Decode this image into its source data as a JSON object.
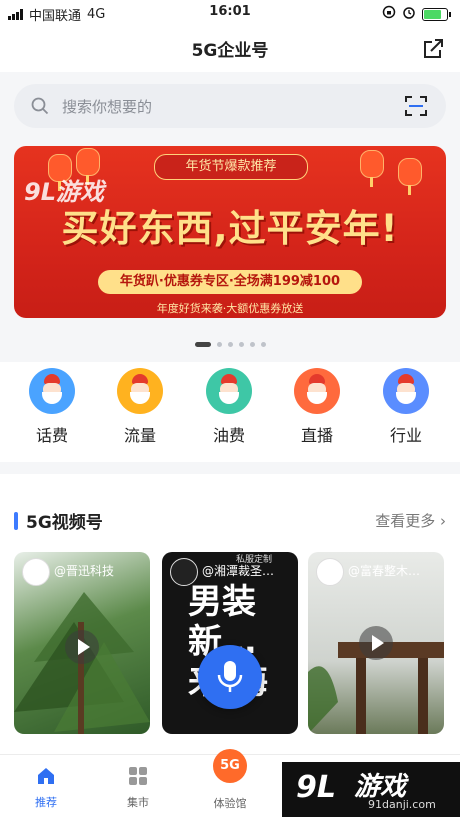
{
  "status_bar": {
    "carrier": "中国联通",
    "network": "4G",
    "time": "16:01"
  },
  "header": {
    "title": "5G企业号"
  },
  "search": {
    "placeholder": "搜索你想要的"
  },
  "banner": {
    "tag": "年货节爆款推荐",
    "headline": "买好东西,过平安年!",
    "promo": "年货趴·优惠券专区·全场满199减100",
    "footnote": "年度好货来袭·大额优惠券放送",
    "watermark": "9L游戏"
  },
  "carousel": {
    "count": 6,
    "active": 0
  },
  "quick_menu": [
    {
      "label": "话费",
      "color": "#4aa3ff"
    },
    {
      "label": "流量",
      "color": "#ffb21f"
    },
    {
      "label": "油费",
      "color": "#3ec7a6"
    },
    {
      "label": "直播",
      "color": "#ff6a3d"
    },
    {
      "label": "行业",
      "color": "#5a8dff"
    }
  ],
  "video_section": {
    "title": "5G视频号",
    "more": "查看更多",
    "cards": [
      {
        "name": "@晋迅科技"
      },
      {
        "name": "@湘潭裁圣…",
        "tag": "私服定制",
        "overlay": "男装 新…来 海"
      },
      {
        "name": "@富春整木…"
      }
    ]
  },
  "tab_bar": {
    "items": [
      {
        "label": "推荐",
        "active": true
      },
      {
        "label": "集市"
      },
      {
        "label": "体验馆",
        "badge": "5G"
      }
    ]
  },
  "corner_watermark": {
    "logo": "9L",
    "text": "游戏",
    "url": "91danji.com"
  }
}
